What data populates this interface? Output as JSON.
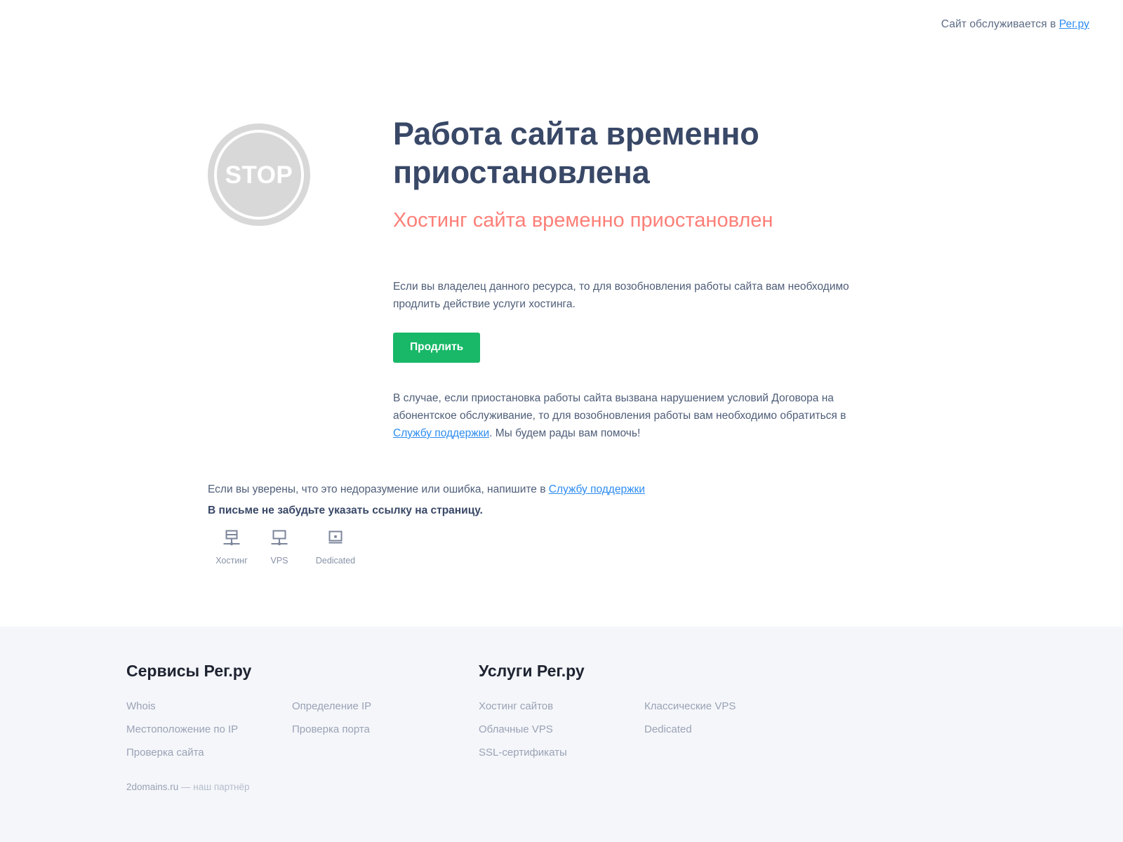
{
  "topbar": {
    "text_prefix": "Сайт обслуживается в ",
    "link_label": "Рег.ру"
  },
  "hero": {
    "stop_icon_label": "STOP",
    "title": "Работа сайта временно приостановлена",
    "subtitle": "Хостинг сайта временно приостановлен",
    "paragraph_1": "Если вы владелец данного ресурса, то для возобновления работы сайта вам необходимо продлить действие услуги хостинга.",
    "renew_button": "Продлить",
    "paragraph_2_part1": "В случае, если приостановка работы сайта вызвана нарушением условий Договора на абонентское обслуживание, то для возобновления работы вам необходимо обратиться в ",
    "paragraph_2_link": "Службу поддержки",
    "paragraph_2_part2": ". Мы будем рады вам помочь!"
  },
  "notice": {
    "line1_part1": "Если вы уверены, что это недоразумение или ошибка, напишите в ",
    "line1_link": "Службу поддержки",
    "line2": "В письме не забудьте указать ссылку на страницу."
  },
  "services": [
    {
      "icon": "server-rack-icon",
      "label": "Хостинг"
    },
    {
      "icon": "monitor-network-icon",
      "label": "VPS"
    },
    {
      "icon": "dedicated-server-icon",
      "label": "Dedicated"
    }
  ],
  "footer": {
    "groups": [
      {
        "title": "Сервисы Рег.ру",
        "columns": [
          [
            "Whois",
            "Местоположение по IP",
            "Проверка сайта"
          ],
          [
            "Определение IP",
            "Проверка порта"
          ]
        ]
      },
      {
        "title": "Услуги Рег.ру",
        "columns": [
          [
            "Хостинг сайтов",
            "Облачные VPS",
            "SSL-сертификаты"
          ],
          [
            "Классические VPS",
            "Dedicated"
          ]
        ]
      }
    ],
    "partner_name": "2domains.ru",
    "partner_suffix": " — наш партнёр"
  },
  "colors": {
    "accent_link": "#2d8cf0",
    "title": "#394867",
    "subtitle": "#fd7f78",
    "button": "#18b868",
    "footer_bg": "#f4f6fa"
  }
}
